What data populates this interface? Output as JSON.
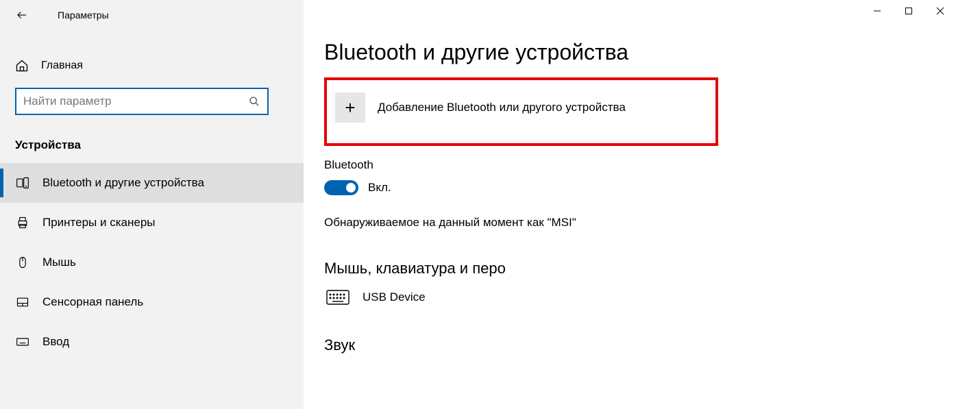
{
  "header": {
    "app_title": "Параметры"
  },
  "sidebar": {
    "home_label": "Главная",
    "search_placeholder": "Найти параметр",
    "section_title": "Устройства",
    "items": [
      {
        "label": "Bluetooth и другие устройства"
      },
      {
        "label": "Принтеры и сканеры"
      },
      {
        "label": "Мышь"
      },
      {
        "label": "Сенсорная панель"
      },
      {
        "label": "Ввод"
      }
    ]
  },
  "main": {
    "page_title": "Bluetooth и другие устройства",
    "add_device_label": "Добавление Bluetooth или другого устройства",
    "bluetooth_label": "Bluetooth",
    "toggle_state_label": "Вкл.",
    "discoverable_text": "Обнаруживаемое на данный момент как \"MSI\"",
    "mouse_section": "Мышь, клавиатура и перо",
    "device_usb": "USB Device",
    "sound_section": "Звук"
  }
}
